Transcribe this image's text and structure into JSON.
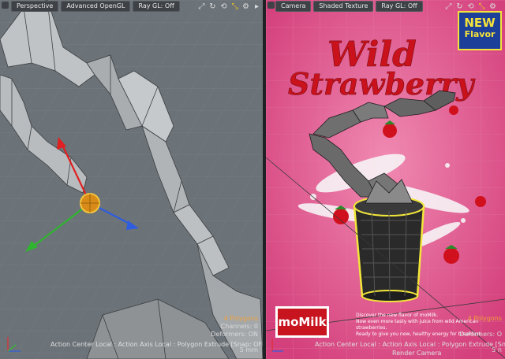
{
  "left_viewport": {
    "tabs": [
      "Perspective",
      "Advanced OpenGL",
      "Ray GL: Off"
    ],
    "status": {
      "polygons": "4 Polygons",
      "channels": "Channels: 0",
      "deformers": "Deformers: ON",
      "unit": "5 mm"
    },
    "action_line": "Action Center Local : Action Axis Local : Polygon Extrude   [Snap: OFF]"
  },
  "right_viewport": {
    "tabs": [
      "Camera",
      "Shaded Texture",
      "Ray GL: Off"
    ],
    "badge": {
      "line1": "NEW",
      "line2": "Flavor"
    },
    "title_line1": "Wild",
    "title_line2": "Strawberry",
    "ad_copy": [
      "Discover the new flavor of moMilk.",
      "Now even more tasty with juice from wild American strawberries.",
      "Ready to give you new, healthy energy for breakfast."
    ],
    "brand": "moMilk",
    "status": {
      "polygons": "4 Polygons",
      "deformers": "Deformers: O",
      "unit": "5 n"
    },
    "action_line": "Action Center Local : Action Axis Local : Polygon Extrude [Snap: OFF]",
    "camera_label": "Render Camera"
  },
  "icons": [
    "maximize-icon",
    "refresh-icon",
    "rotate-icon",
    "move-icon",
    "gear-icon",
    "dropdown-arrow-icon",
    "axis-gizmo-icon"
  ],
  "colors": {
    "viewport_bg": "#6b7278",
    "poster_bg": "#dd4c86",
    "accent_yellow": "#f2c318",
    "title_red": "#c9121c"
  }
}
